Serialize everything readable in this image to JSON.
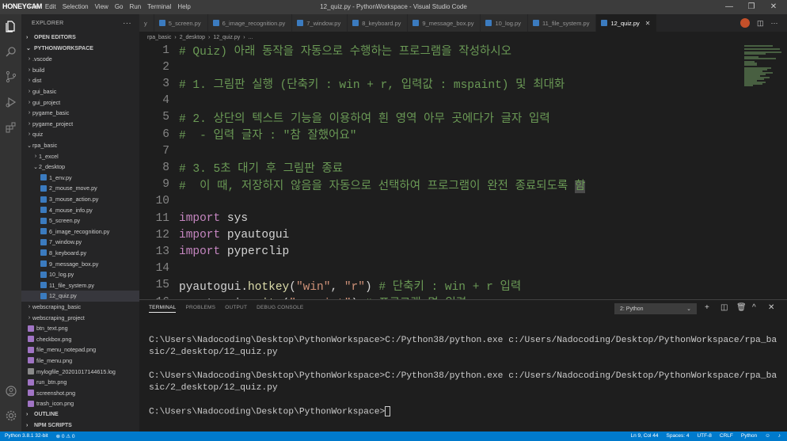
{
  "watermark": "HONEYCAM",
  "window": {
    "title": "12_quiz.py - PythonWorkspace - Visual Studio Code",
    "menu": [
      "File",
      "Edit",
      "Selection",
      "View",
      "Go",
      "Run",
      "Terminal",
      "Help"
    ]
  },
  "sidebar": {
    "header": "EXPLORER",
    "open_editors": "OPEN EDITORS",
    "workspace": "PYTHONWORKSPACE",
    "tree": [
      {
        "label": ".vscode",
        "type": "folder",
        "depth": 1,
        "expanded": false
      },
      {
        "label": "build",
        "type": "folder",
        "depth": 1,
        "expanded": false
      },
      {
        "label": "dist",
        "type": "folder",
        "depth": 1,
        "expanded": false
      },
      {
        "label": "gui_basic",
        "type": "folder",
        "depth": 1,
        "expanded": false
      },
      {
        "label": "gui_project",
        "type": "folder",
        "depth": 1,
        "expanded": false
      },
      {
        "label": "pygame_basic",
        "type": "folder",
        "depth": 1,
        "expanded": false
      },
      {
        "label": "pygame_project",
        "type": "folder",
        "depth": 1,
        "expanded": false
      },
      {
        "label": "quiz",
        "type": "folder",
        "depth": 1,
        "expanded": false
      },
      {
        "label": "rpa_basic",
        "type": "folder",
        "depth": 1,
        "expanded": true
      },
      {
        "label": "1_excel",
        "type": "folder",
        "depth": 2,
        "expanded": false
      },
      {
        "label": "2_desktop",
        "type": "folder",
        "depth": 2,
        "expanded": true
      },
      {
        "label": "1_env.py",
        "type": "py",
        "depth": 3
      },
      {
        "label": "2_mouse_move.py",
        "type": "py",
        "depth": 3
      },
      {
        "label": "3_mouse_action.py",
        "type": "py",
        "depth": 3
      },
      {
        "label": "4_mouse_info.py",
        "type": "py",
        "depth": 3
      },
      {
        "label": "5_screen.py",
        "type": "py",
        "depth": 3
      },
      {
        "label": "6_image_recognition.py",
        "type": "py",
        "depth": 3
      },
      {
        "label": "7_window.py",
        "type": "py",
        "depth": 3
      },
      {
        "label": "8_keyboard.py",
        "type": "py",
        "depth": 3
      },
      {
        "label": "9_message_box.py",
        "type": "py",
        "depth": 3
      },
      {
        "label": "10_log.py",
        "type": "py",
        "depth": 3
      },
      {
        "label": "11_file_system.py",
        "type": "py",
        "depth": 3
      },
      {
        "label": "12_quiz.py",
        "type": "py",
        "depth": 3,
        "selected": true
      },
      {
        "label": "webscraping_basic",
        "type": "folder",
        "depth": 1,
        "expanded": false
      },
      {
        "label": "webscraping_project",
        "type": "folder",
        "depth": 1,
        "expanded": false
      },
      {
        "label": "btn_text.png",
        "type": "img",
        "depth": 1
      },
      {
        "label": "checkbox.png",
        "type": "img",
        "depth": 1
      },
      {
        "label": "file_menu_notepad.png",
        "type": "img",
        "depth": 1
      },
      {
        "label": "file_menu.png",
        "type": "img",
        "depth": 1
      },
      {
        "label": "mylogfile_20201017144615.log",
        "type": "log",
        "depth": 1
      },
      {
        "label": "run_btn.png",
        "type": "img",
        "depth": 1
      },
      {
        "label": "screenshot.png",
        "type": "img",
        "depth": 1
      },
      {
        "label": "trash_icon.png",
        "type": "img",
        "depth": 1
      }
    ],
    "outline": "OUTLINE",
    "npm_scripts": "NPM SCRIPTS"
  },
  "tabs": [
    {
      "label": "y",
      "active": false
    },
    {
      "label": "5_screen.py",
      "active": false
    },
    {
      "label": "6_image_recognition.py",
      "active": false
    },
    {
      "label": "7_window.py",
      "active": false
    },
    {
      "label": "8_keyboard.py",
      "active": false
    },
    {
      "label": "9_message_box.py",
      "active": false
    },
    {
      "label": "10_log.py",
      "active": false
    },
    {
      "label": "11_file_system.py",
      "active": false
    },
    {
      "label": "12_quiz.py",
      "active": true
    }
  ],
  "breadcrumb": [
    "rpa_basic",
    "2_desktop",
    "12_quiz.py",
    "..."
  ],
  "editor": {
    "lines": [
      {
        "n": "1",
        "parts": [
          {
            "c": "cmt",
            "t": "# Quiz) 아래 동작을 자동으로 수행하는 프로그램을 작성하시오"
          }
        ]
      },
      {
        "n": "2",
        "parts": []
      },
      {
        "n": "3",
        "parts": [
          {
            "c": "cmt",
            "t": "# 1. 그림판 실행 (단축키 : win + r, 입력값 : mspaint) 및 최대화"
          }
        ]
      },
      {
        "n": "4",
        "parts": []
      },
      {
        "n": "5",
        "parts": [
          {
            "c": "cmt",
            "t": "# 2. 상단의 텍스트 기능을 이용하여 흰 영역 아무 곳에다가 글자 입력"
          }
        ]
      },
      {
        "n": "6",
        "parts": [
          {
            "c": "cmt",
            "t": "#  - 입력 글자 : \"참 잘했어요\""
          }
        ]
      },
      {
        "n": "7",
        "parts": []
      },
      {
        "n": "8",
        "parts": [
          {
            "c": "cmt",
            "t": "# 3. 5초 대기 후 그림판 종료"
          }
        ]
      },
      {
        "n": "9",
        "parts": [
          {
            "c": "cmt",
            "t": "#  이 때, 저장하지 않음을 자동으로 선택하여 프로그램이 완전 종료되도록 "
          },
          {
            "c": "cursorchar",
            "t": "함"
          }
        ]
      },
      {
        "n": "10",
        "parts": []
      },
      {
        "n": "11",
        "parts": [
          {
            "c": "kw",
            "t": "import"
          },
          {
            "c": "nm",
            "t": " sys"
          }
        ]
      },
      {
        "n": "12",
        "parts": [
          {
            "c": "kw",
            "t": "import"
          },
          {
            "c": "nm",
            "t": " pyautogui"
          }
        ]
      },
      {
        "n": "13",
        "parts": [
          {
            "c": "kw",
            "t": "import"
          },
          {
            "c": "nm",
            "t": " pyperclip"
          }
        ]
      },
      {
        "n": "14",
        "parts": []
      },
      {
        "n": "15",
        "parts": [
          {
            "c": "nm",
            "t": "pyautogui."
          },
          {
            "c": "fn",
            "t": "hotkey"
          },
          {
            "c": "nm",
            "t": "("
          },
          {
            "c": "str",
            "t": "\"win\""
          },
          {
            "c": "nm",
            "t": ", "
          },
          {
            "c": "str",
            "t": "\"r\""
          },
          {
            "c": "nm",
            "t": ") "
          },
          {
            "c": "cmt",
            "t": "# 단축키 : win + r 입력"
          }
        ]
      },
      {
        "n": "16",
        "parts": [
          {
            "c": "nm",
            "t": "pyautogui."
          },
          {
            "c": "fn",
            "t": "write"
          },
          {
            "c": "nm",
            "t": "("
          },
          {
            "c": "str",
            "t": "\"mspaint\""
          },
          {
            "c": "nm",
            "t": ") "
          },
          {
            "c": "cmt",
            "t": "# 프로그램 명 입력"
          }
        ]
      }
    ]
  },
  "panel": {
    "tabs": [
      "TERMINAL",
      "PROBLEMS",
      "OUTPUT",
      "DEBUG CONSOLE"
    ],
    "active_tab": "TERMINAL",
    "terminal_select": "2: Python",
    "terminal_lines": [
      "C:\\Users\\Nadocoding\\Desktop\\PythonWorkspace>C:/Python38/python.exe c:/Users/Nadocoding/Desktop/PythonWorkspace/rpa_ba",
      "sic/2_desktop/12_quiz.py",
      "",
      "C:\\Users\\Nadocoding\\Desktop\\PythonWorkspace>C:/Python38/python.exe c:/Users/Nadocoding/Desktop/PythonWorkspace/rpa_ba",
      "sic/2_desktop/12_quiz.py",
      "",
      "C:\\Users\\Nadocoding\\Desktop\\PythonWorkspace>"
    ]
  },
  "statusbar": {
    "interpreter": "Python 3.8.1 32-bit",
    "problems": "⊗ 0 ⚠ 0",
    "position": "Ln 9, Col 44",
    "spaces": "Spaces: 4",
    "encoding": "UTF-8",
    "eol": "CRLF",
    "language": "Python"
  },
  "colors": {
    "accent": "#007acc",
    "comment": "#6a9955",
    "keyword": "#c586c0",
    "string": "#ce9178"
  }
}
